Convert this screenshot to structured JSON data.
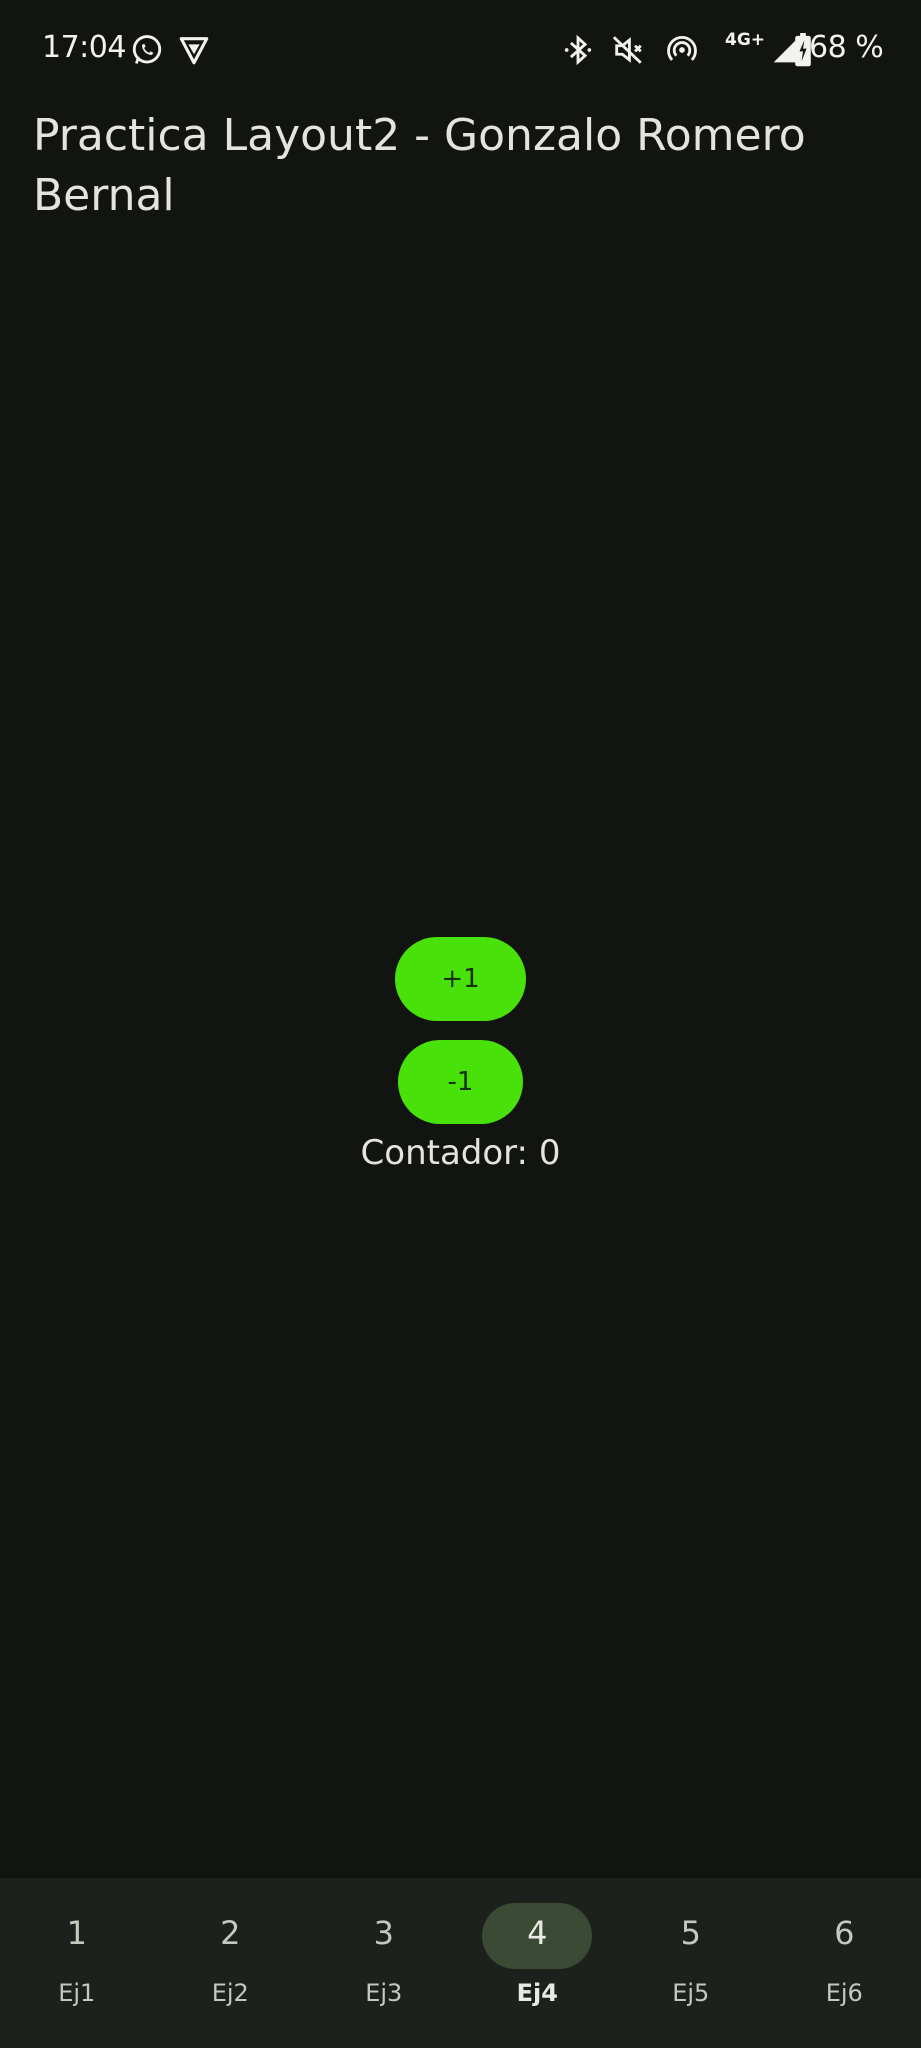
{
  "status_bar": {
    "time": "17:04",
    "left_icons": [
      "whatsapp-icon",
      "vpn-shield-icon"
    ],
    "right_icons": [
      "bluetooth-icon",
      "mute-icon",
      "hotspot-icon",
      "signal-icon",
      "battery-charging-icon"
    ],
    "network": "4G+",
    "battery": "68 %"
  },
  "app": {
    "title": "Practica Layout2 - Gonzalo Romero Bernal"
  },
  "main": {
    "plus_label": "+1",
    "minus_label": "-1",
    "counter_text": "Contador: 0"
  },
  "bottom_nav": {
    "active_index": 3,
    "items": [
      {
        "icon": "1",
        "label": "Ej1"
      },
      {
        "icon": "2",
        "label": "Ej2"
      },
      {
        "icon": "3",
        "label": "Ej3"
      },
      {
        "icon": "4",
        "label": "Ej4"
      },
      {
        "icon": "5",
        "label": "Ej5"
      },
      {
        "icon": "6",
        "label": "Ej6"
      }
    ]
  },
  "colors": {
    "background": "#121411",
    "button": "#48e20a",
    "nav_background": "#1d201c",
    "nav_active_indicator": "#3a4a35"
  }
}
